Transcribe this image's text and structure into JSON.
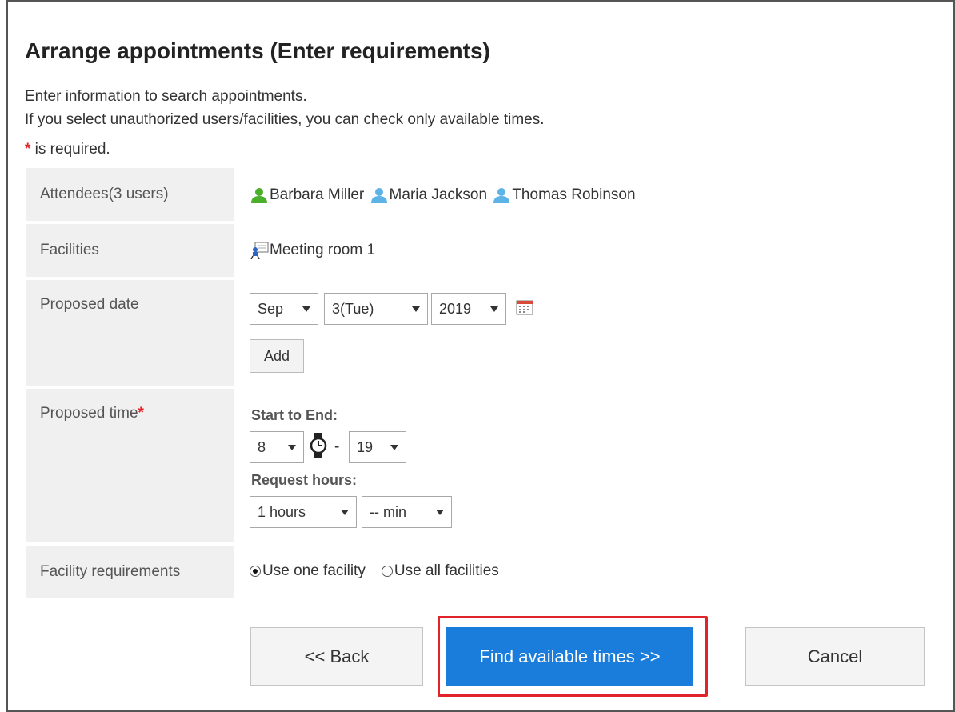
{
  "page": {
    "title": "Arrange appointments (Enter requirements)",
    "description_line1": "Enter information to search appointments.",
    "description_line2": "If you select unauthorized users/facilities, you can check only available times.",
    "required_star": "*",
    "required_text": " is required."
  },
  "form": {
    "attendees": {
      "label": "Attendees(3 users)",
      "users": [
        {
          "name": "Barbara Miller",
          "icon_color": "#4caf2c"
        },
        {
          "name": "Maria Jackson",
          "icon_color": "#5eb3e6"
        },
        {
          "name": "Thomas Robinson",
          "icon_color": "#5eb3e6"
        }
      ]
    },
    "facilities": {
      "label": "Facilities",
      "items": [
        "Meeting room 1"
      ]
    },
    "proposed_date": {
      "label": "Proposed date",
      "month": "Sep",
      "day": "3(Tue)",
      "year": "2019",
      "add_label": "Add"
    },
    "proposed_time": {
      "label": "Proposed time",
      "required_star": "*",
      "start_to_end_label": "Start to End:",
      "start_hour": "8",
      "separator": "-",
      "end_hour": "19",
      "request_hours_label": "Request hours:",
      "hours": "1 hours",
      "minutes": "-- min"
    },
    "facility_requirements": {
      "label": "Facility requirements",
      "options": [
        {
          "label": "Use one facility",
          "selected": true
        },
        {
          "label": "Use all facilities",
          "selected": false
        }
      ]
    }
  },
  "buttons": {
    "back": "<< Back",
    "find": "Find available times >>",
    "cancel": "Cancel"
  },
  "colors": {
    "primary": "#1a7ddc",
    "required": "#e0242a",
    "highlight": "#e0242a"
  }
}
